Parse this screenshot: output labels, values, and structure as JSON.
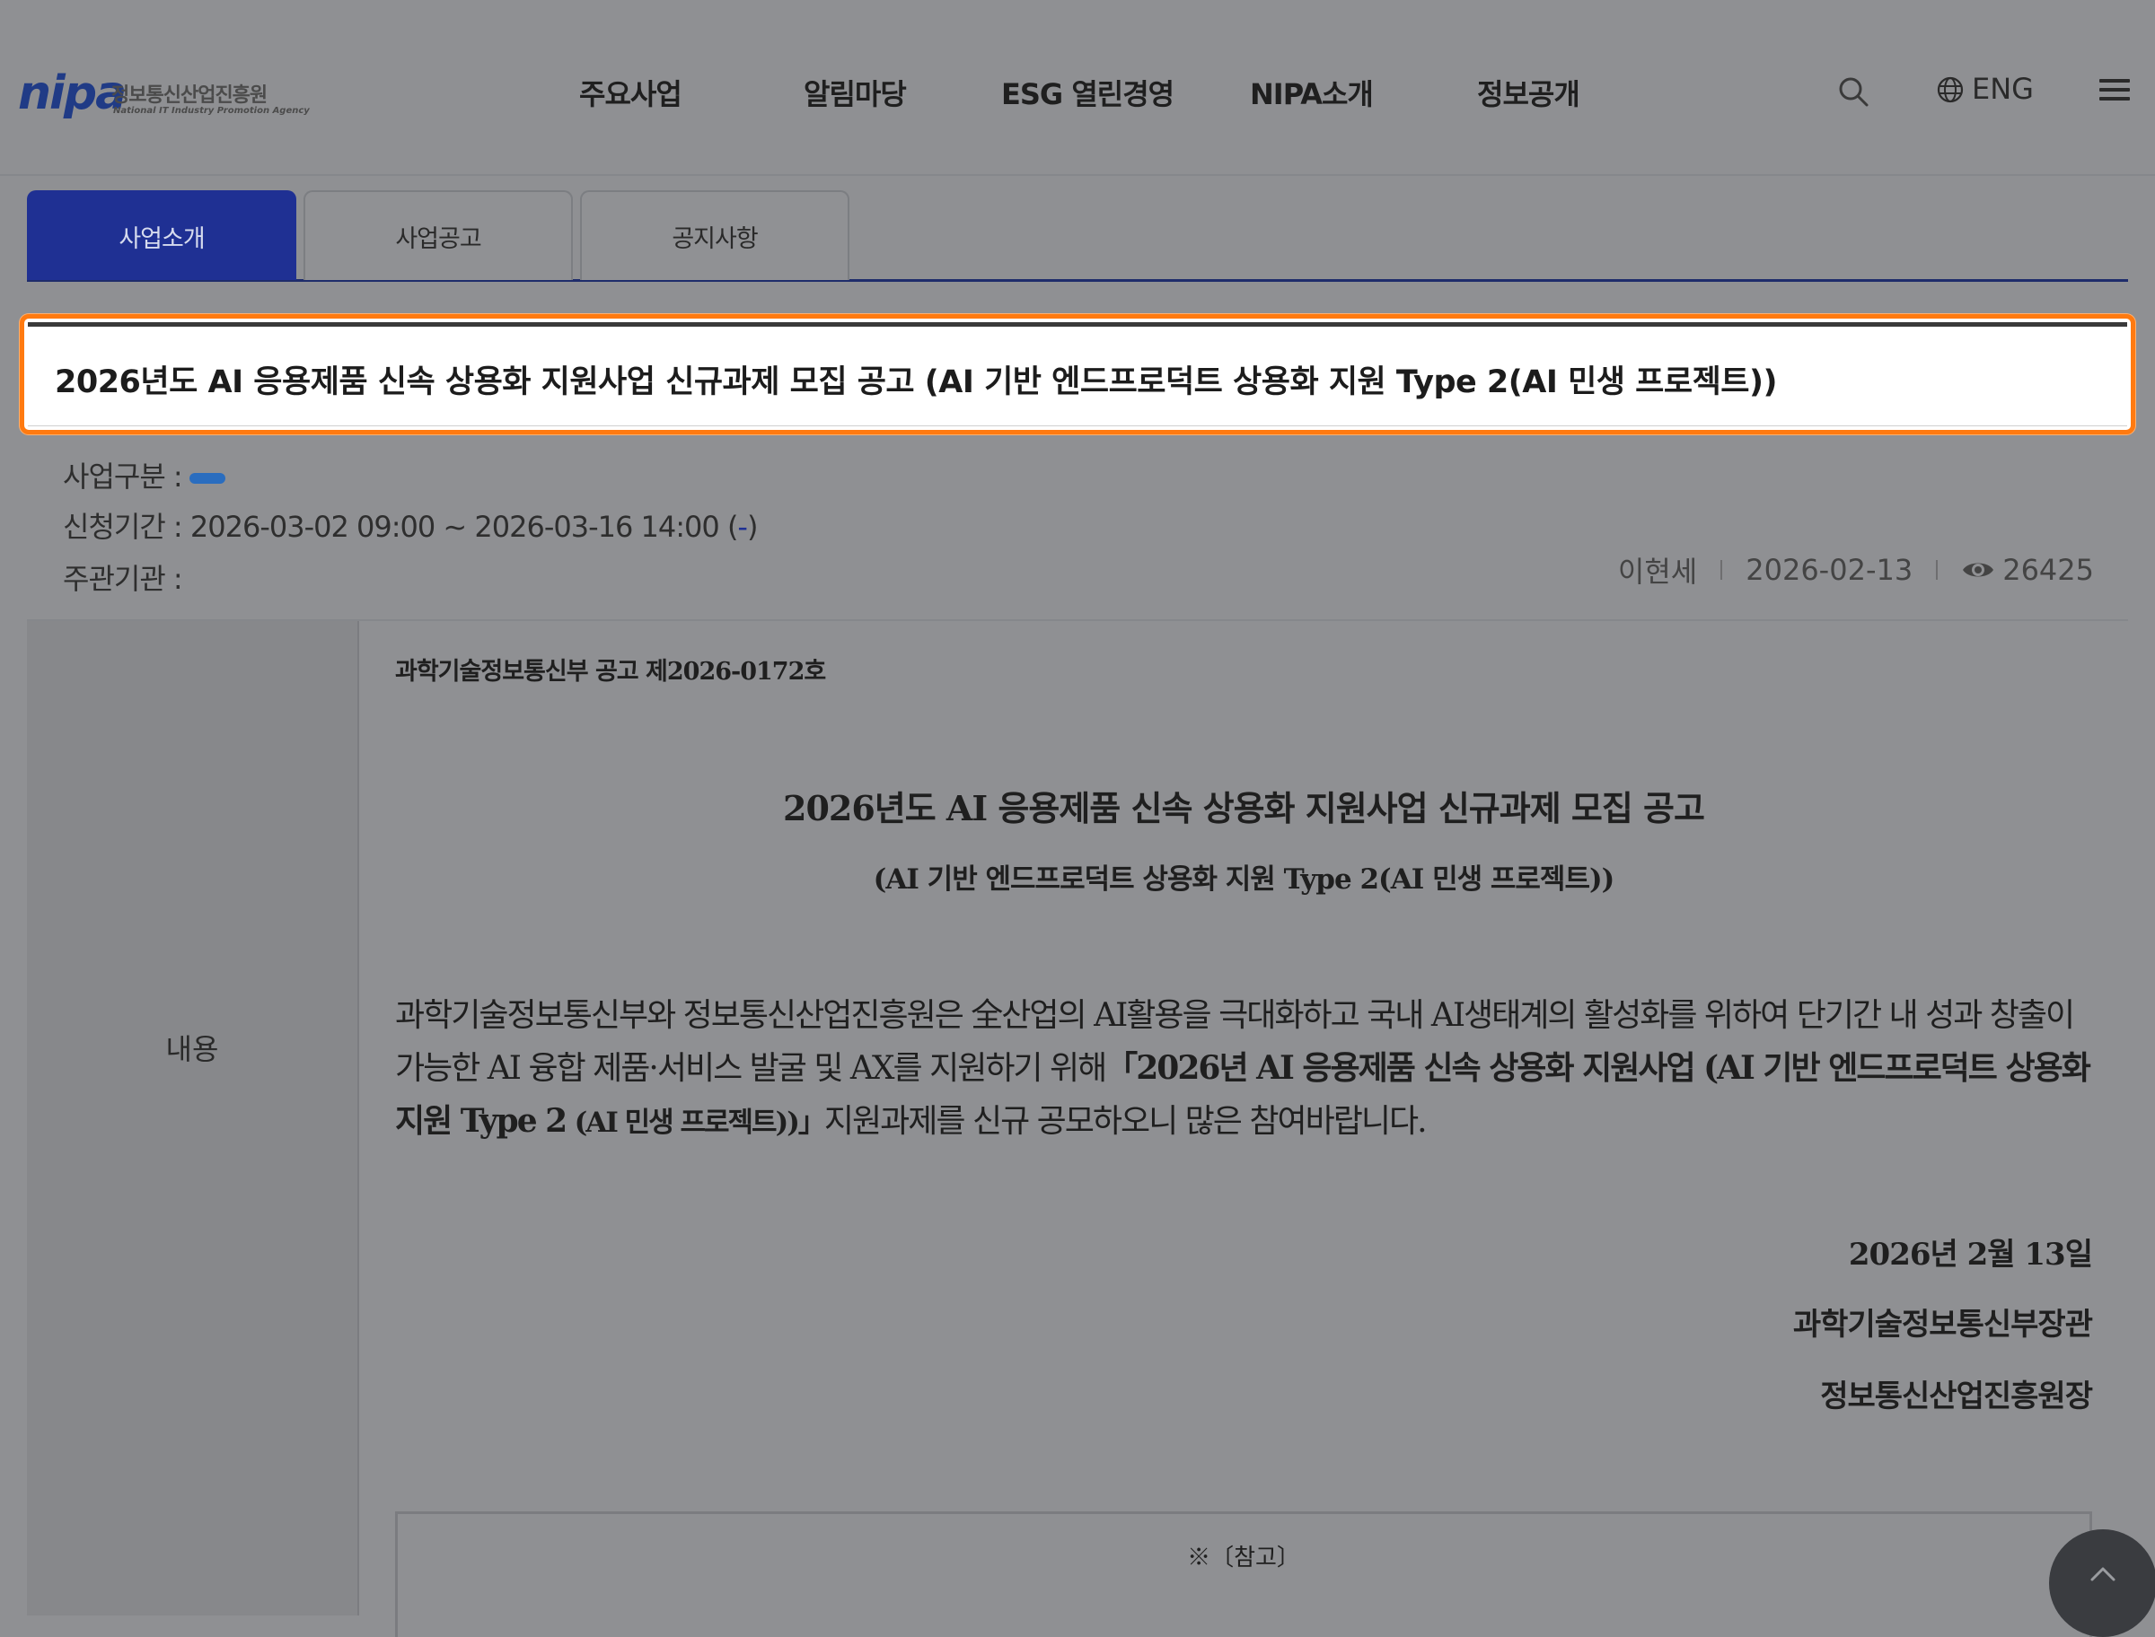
{
  "logo": {
    "mark": "nipa",
    "name_ko": "정보통신산업진흥원",
    "name_en": "National IT Industry Promotion Agency"
  },
  "nav": {
    "items": [
      "주요사업",
      "알림마당",
      "ESG 열린경영",
      "NIPA소개",
      "정보공개"
    ],
    "lang_label": "ENG"
  },
  "tabs": [
    {
      "label": "사업소개",
      "active": true
    },
    {
      "label": "사업공고",
      "active": false
    },
    {
      "label": "공지사항",
      "active": false
    }
  ],
  "post": {
    "title": "2026년도 AI 응용제품 신속 상용화 지원사업 신규과제 모집 공고 (AI 기반 엔드프로덕트 상용화 지원 Type 2(AI 민생 프로젝트))",
    "category_label": "사업구분 :",
    "period_label": "신청기간 :",
    "period_value": "2026-03-02 09:00 ~ 2026-03-16 14:00",
    "period_status_open": "(",
    "period_status": "-",
    "period_status_close": ")",
    "org_label": "주관기관 :",
    "author": "이현세",
    "date": "2026-02-13",
    "views": "26425"
  },
  "content": {
    "row_label": "내용",
    "notice_no": "과학기술정보통신부 공고 제2026-0172호",
    "doc_title": "2026년도 AI 응용제품 신속 상용화 지원사업 신규과제 모집 공고",
    "doc_subtitle": "(AI 기반 엔드프로덕트 상용화 지원 Type 2(AI 민생 프로젝트))",
    "body_prefix": "과학기술정보통신부와 정보통신산업진흥원은 全산업의 AI활용을 극대화하고 국내 AI생태계의 활성화를 위하여 단기간 내 성과 창출이 가능한 AI 융합 제품·서비스 발굴 및 AX를 지원하기 위해",
    "body_bold": "「2026년 AI 응용제품 신속 상용화 지원사업 (AI 기반 엔드프로덕트 상용화 지원 Type 2",
    "body_bold_small": "(AI 민생 프로젝트))」",
    "body_suffix": "지원과제를 신규 공모하오니 많은 참여바랍니다.",
    "sign_date": "2026년 2월 13일",
    "sign_org1": "과학기술정보통신부장관",
    "sign_org2": "정보통신산업진흥원장",
    "ref_label": "※〔참고〕"
  },
  "colors": {
    "accent": "#1f3093",
    "highlight_border": "#ff7a10",
    "badge": "#2a6dbf"
  },
  "icons": [
    "search-icon",
    "globe-icon",
    "menu-icon",
    "eye-icon",
    "chevron-up-icon"
  ]
}
